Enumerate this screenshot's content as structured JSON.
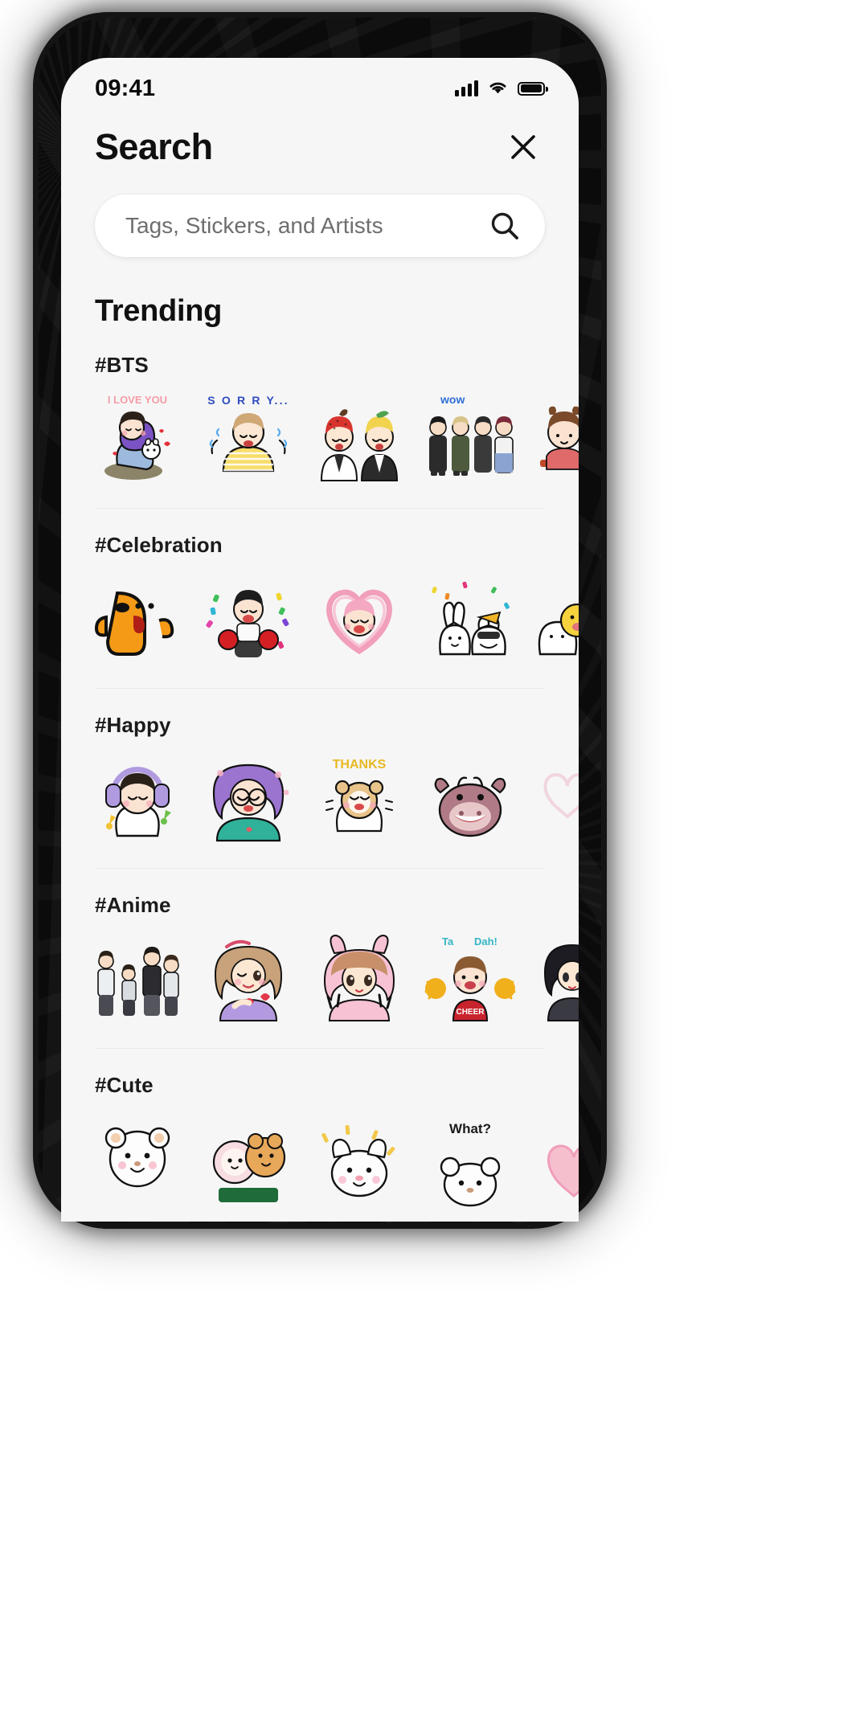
{
  "status_bar": {
    "time": "09:41",
    "signal_icon": "cellular-signal-icon",
    "wifi_icon": "wifi-icon",
    "battery_icon": "battery-full-icon"
  },
  "header": {
    "title": "Search",
    "close_icon": "close-x-icon"
  },
  "search": {
    "placeholder": "Tags, Stickers, and Artists",
    "value": "",
    "icon": "search-magnifier-icon"
  },
  "trending": {
    "heading": "Trending"
  },
  "categories": [
    {
      "label": "#BTS",
      "stickers": [
        {
          "name": "i-love-you-hug-sticker",
          "caption": "I LOVE YOU",
          "caption_color": "#f79ca8"
        },
        {
          "name": "sorry-crying-sticker",
          "caption": "S O R R Y...",
          "caption_color": "#2f4bbf"
        },
        {
          "name": "strawberry-lemon-duo-sticker",
          "caption": "",
          "caption_color": ""
        },
        {
          "name": "wow-group-sticker",
          "caption": "wow",
          "caption_color": "#2f6fd6"
        },
        {
          "name": "cat-ears-girl-sticker",
          "caption": "",
          "caption_color": ""
        }
      ]
    },
    {
      "label": "#Celebration",
      "stickers": [
        {
          "name": "orange-bear-cheer-sticker",
          "caption": "",
          "caption_color": ""
        },
        {
          "name": "confetti-boxer-sticker",
          "caption": "",
          "caption_color": ""
        },
        {
          "name": "pink-heart-girl-sticker",
          "caption": "",
          "caption_color": ""
        },
        {
          "name": "party-bunny-dog-sticker",
          "caption": "",
          "caption_color": ""
        },
        {
          "name": "yellow-party-sticker",
          "caption": "",
          "caption_color": ""
        }
      ]
    },
    {
      "label": "#Happy",
      "stickers": [
        {
          "name": "headphones-music-sticker",
          "caption": "",
          "caption_color": ""
        },
        {
          "name": "purple-hair-glasses-sticker",
          "caption": "",
          "caption_color": ""
        },
        {
          "name": "thanks-bear-sticker",
          "caption": "THANKS",
          "caption_color": "#e8b923"
        },
        {
          "name": "happy-cow-sticker",
          "caption": "",
          "caption_color": ""
        },
        {
          "name": "faded-heart-sticker",
          "caption": "",
          "caption_color": ""
        }
      ]
    },
    {
      "label": "#Anime",
      "stickers": [
        {
          "name": "school-trio-sticker",
          "caption": "",
          "caption_color": ""
        },
        {
          "name": "finger-heart-girl-sticker",
          "caption": "",
          "caption_color": ""
        },
        {
          "name": "bunny-hood-peace-sticker",
          "caption": "",
          "caption_color": ""
        },
        {
          "name": "ta-dah-cheer-sticker",
          "caption": "Ta  Dah!",
          "caption_color": "#35b5c4"
        },
        {
          "name": "dark-hair-girl-sticker",
          "caption": "",
          "caption_color": ""
        }
      ]
    },
    {
      "label": "#Cute",
      "stickers": [
        {
          "name": "white-bear-cute-sticker",
          "caption": "",
          "caption_color": ""
        },
        {
          "name": "sheep-hug-sticker",
          "caption": "",
          "caption_color": ""
        },
        {
          "name": "white-puppy-sticker",
          "caption": "",
          "caption_color": ""
        },
        {
          "name": "what-bear-sticker",
          "caption": "What?",
          "caption_color": "#1b1b1b"
        },
        {
          "name": "pink-heart-cute-sticker",
          "caption": "",
          "caption_color": ""
        }
      ]
    }
  ],
  "colors": {
    "screen_bg": "#f6f6f6",
    "card_bg": "#ffffff",
    "text_primary": "#101010",
    "text_secondary": "#6e6e6e",
    "divider": "#e9e9e9",
    "frame": "#0b0b0b"
  }
}
